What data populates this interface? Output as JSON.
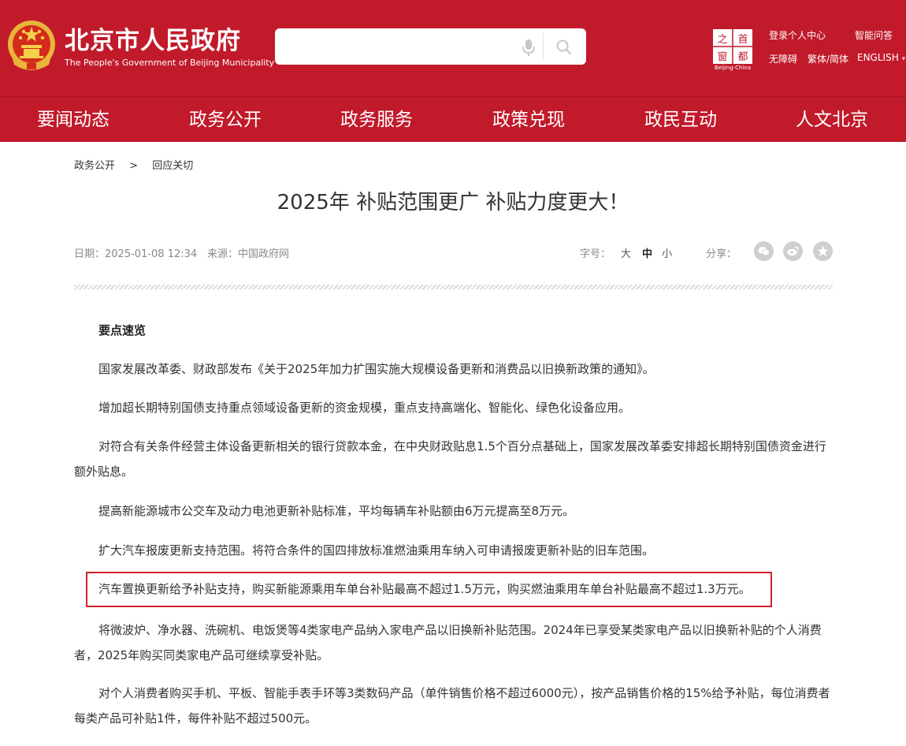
{
  "header": {
    "site_title": "北京市人民政府",
    "site_subtitle": "The People's Government of Beijing Municipality",
    "search": {
      "placeholder": ""
    },
    "capital_logo_text": "Beijing-China",
    "capital_logo_chars": [
      "之",
      "首",
      "窗",
      "都"
    ],
    "links": {
      "login": "登录个人中心",
      "smart_qa": "智能问答",
      "accessibility": "无障碍",
      "traditional_simplified": "繁体/简体",
      "english": "ENGLISH",
      "english_arrow": "▾"
    },
    "colors": {
      "brand_red": "#c11a2b"
    }
  },
  "nav": {
    "items": [
      "要闻动态",
      "政务公开",
      "政务服务",
      "政策兑现",
      "政民互动",
      "人文北京"
    ]
  },
  "breadcrumb": {
    "items": [
      "政务公开",
      "回应关切"
    ],
    "separator": ">"
  },
  "article": {
    "title": "2025年 补贴范围更广 补贴力度更大！",
    "date_label": "日期：",
    "date": "2025-01-08 12:34",
    "source_label": "来源：",
    "source": "中国政府网",
    "font_size_label": "字号：",
    "font_sizes": [
      "大",
      "中",
      "小"
    ],
    "share_label": "分享：",
    "share_icons": [
      "wechat-icon",
      "weibo-icon",
      "favorite-icon"
    ],
    "section_heading": "要点速览",
    "paragraphs": [
      "国家发展改革委、财政部发布《关于2025年加力扩围实施大规模设备更新和消费品以旧换新政策的通知》。",
      "增加超长期特别国债支持重点领域设备更新的资金规模，重点支持高端化、智能化、绿色化设备应用。",
      "对符合有关条件经营主体设备更新相关的银行贷款本金，在中央财政贴息1.5个百分点基础上，国家发展改革委安排超长期特别国债资金进行额外贴息。",
      "提高新能源城市公交车及动力电池更新补贴标准，平均每辆车补贴额由6万元提高至8万元。",
      "扩大汽车报废更新支持范围。将符合条件的国四排放标准燃油乘用车纳入可申请报废更新补贴的旧车范围。",
      "汽车置换更新给予补贴支持，购买新能源乘用车单台补贴最高不超过1.5万元，购买燃油乘用车单台补贴最高不超过1.3万元。",
      "将微波炉、净水器、洗碗机、电饭煲等4类家电产品纳入家电产品以旧换新补贴范围。2024年已享受某类家电产品以旧换新补贴的个人消费者，2025年购买同类家电产品可继续享受补贴。",
      "对个人消费者购买手机、平板、智能手表手环等3类数码产品（单件销售价格不超过6000元），按产品销售价格的15%给予补贴，每位消费者每类产品可补贴1件，每件补贴不超过500元。"
    ],
    "highlight_color": "#d3212d"
  }
}
